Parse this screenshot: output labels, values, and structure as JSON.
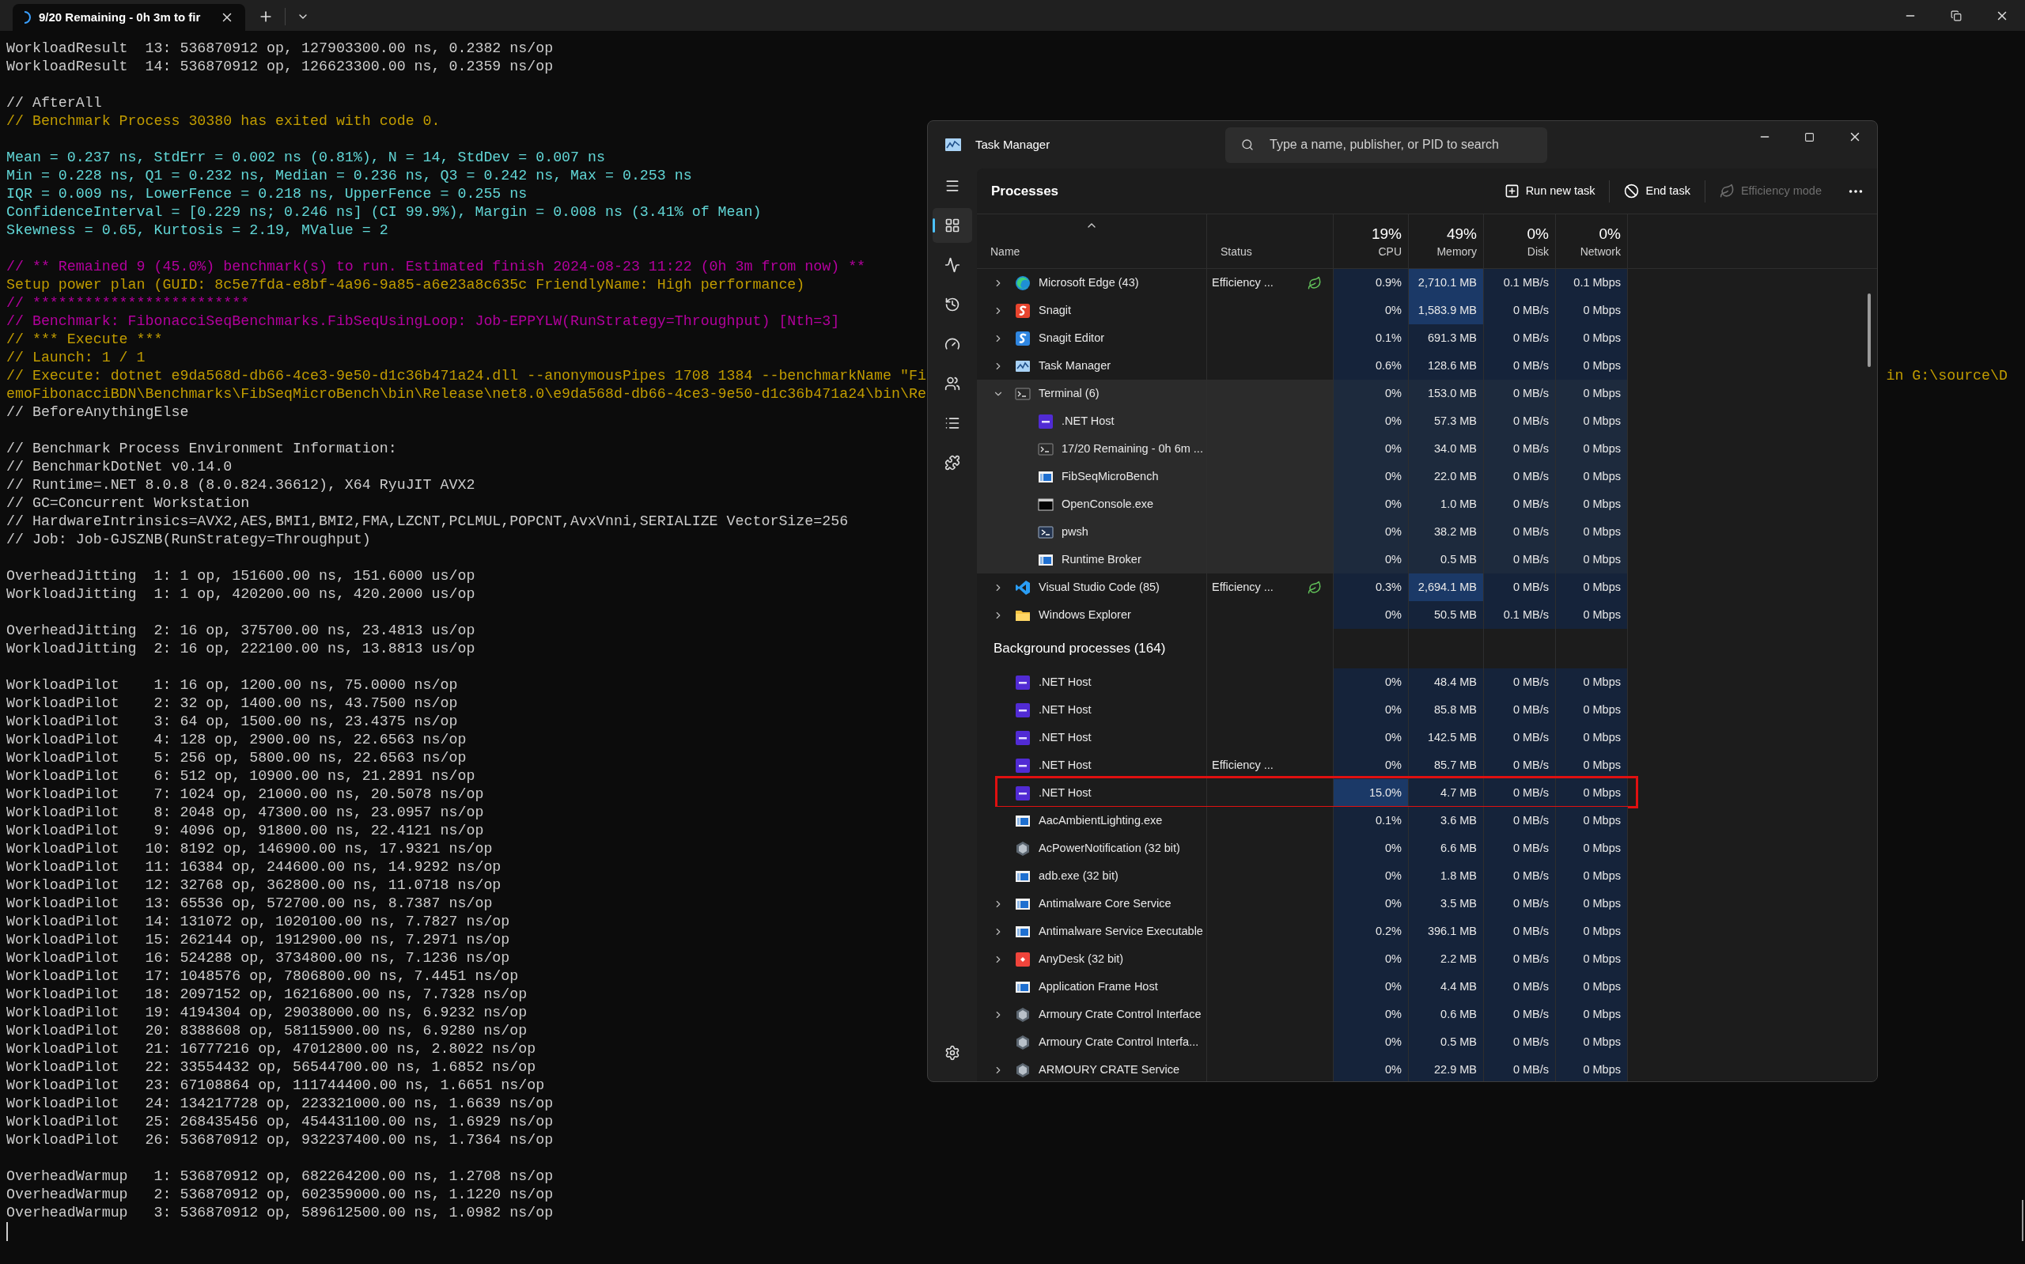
{
  "terminal": {
    "tab": {
      "title": "9/20 Remaining - 0h 3m to fir",
      "busy": true
    },
    "blocks": [
      [
        {
          "text": "WorkloadResult  13: 536870912 op, 127903300.00 ns, 0.2382 ns/op",
          "color": "#cccccc"
        },
        {
          "text": "WorkloadResult  14: 536870912 op, 126623300.00 ns, 0.2359 ns/op",
          "color": "#cccccc"
        }
      ],
      [
        {
          "text": "// AfterAll",
          "color": "#cccccc"
        },
        {
          "text": "// Benchmark Process 30380 has exited with code 0.",
          "color": "#c19c00"
        }
      ],
      [
        {
          "text": "Mean = 0.237 ns, StdErr = 0.002 ns (0.81%), N = 14, StdDev = 0.007 ns",
          "color": "#61d6d6"
        },
        {
          "text": "Min = 0.228 ns, Q1 = 0.232 ns, Median = 0.236 ns, Q3 = 0.242 ns, Max = 0.253 ns",
          "color": "#61d6d6"
        },
        {
          "text": "IQR = 0.009 ns, LowerFence = 0.218 ns, UpperFence = 0.255 ns",
          "color": "#61d6d6"
        },
        {
          "text": "ConfidenceInterval = [0.229 ns; 0.246 ns] (CI 99.9%), Margin = 0.008 ns (3.41% of Mean)",
          "color": "#61d6d6"
        },
        {
          "text": "Skewness = 0.65, Kurtosis = 2.19, MValue = 2",
          "color": "#61d6d6"
        }
      ],
      [
        {
          "text": "// ** Remained 9 (45.0%) benchmark(s) to run. Estimated finish 2024-08-23 11:22 (0h 3m from now) **",
          "color": "#b4009e"
        },
        {
          "text": "Setup power plan (GUID: 8c5e7fda-e8bf-4a96-9a85-a6e23a8c635c FriendlyName: High performance)",
          "color": "#c19c00"
        },
        {
          "text": "// *************************",
          "color": "#b4009e"
        },
        {
          "text": "// Benchmark: FibonacciSeqBenchmarks.FibSeqUsingLoop: Job-EPPYLW(RunStrategy=Throughput) [Nth=3]",
          "color": "#b4009e"
        },
        {
          "text": "// *** Execute ***",
          "color": "#c19c00"
        },
        {
          "text": "// Launch: 1 / 1",
          "color": "#c19c00"
        },
        {
          "text": "// Execute: dotnet e9da568d-db66-4ce3-9e50-d1c36b471a24.dll --anonymousPipes 1708 1384 --benchmarkName \"Fi",
          "right": "in G:\\source\\D",
          "color": "#c19c00"
        },
        {
          "text": "emoFibonacciBDN\\Benchmarks\\FibSeqMicroBench\\bin\\Release\\net8.0\\e9da568d-db66-4ce3-9e50-d1c36b471a24\\bin\\Re",
          "color": "#c19c00"
        },
        {
          "text": "// BeforeAnythingElse",
          "color": "#cccccc"
        }
      ],
      [
        {
          "text": "// Benchmark Process Environment Information:",
          "color": "#cccccc"
        },
        {
          "text": "// BenchmarkDotNet v0.14.0",
          "color": "#cccccc"
        },
        {
          "text": "// Runtime=.NET 8.0.8 (8.0.824.36612), X64 RyuJIT AVX2",
          "color": "#cccccc"
        },
        {
          "text": "// GC=Concurrent Workstation",
          "color": "#cccccc"
        },
        {
          "text": "// HardwareIntrinsics=AVX2,AES,BMI1,BMI2,FMA,LZCNT,PCLMUL,POPCNT,AvxVnni,SERIALIZE VectorSize=256",
          "color": "#cccccc"
        },
        {
          "text": "// Job: Job-GJSZNB(RunStrategy=Throughput)",
          "color": "#cccccc"
        }
      ],
      [
        {
          "text": "OverheadJitting  1: 1 op, 151600.00 ns, 151.6000 us/op",
          "color": "#cccccc"
        },
        {
          "text": "WorkloadJitting  1: 1 op, 420200.00 ns, 420.2000 us/op",
          "color": "#cccccc"
        }
      ],
      [
        {
          "text": "OverheadJitting  2: 16 op, 375700.00 ns, 23.4813 us/op",
          "color": "#cccccc"
        },
        {
          "text": "WorkloadJitting  2: 16 op, 222100.00 ns, 13.8813 us/op",
          "color": "#cccccc"
        }
      ],
      [
        {
          "text": "WorkloadPilot    1: 16 op, 1200.00 ns, 75.0000 ns/op",
          "color": "#cccccc"
        },
        {
          "text": "WorkloadPilot    2: 32 op, 1400.00 ns, 43.7500 ns/op",
          "color": "#cccccc"
        },
        {
          "text": "WorkloadPilot    3: 64 op, 1500.00 ns, 23.4375 ns/op",
          "color": "#cccccc"
        },
        {
          "text": "WorkloadPilot    4: 128 op, 2900.00 ns, 22.6563 ns/op",
          "color": "#cccccc"
        },
        {
          "text": "WorkloadPilot    5: 256 op, 5800.00 ns, 22.6563 ns/op",
          "color": "#cccccc"
        },
        {
          "text": "WorkloadPilot    6: 512 op, 10900.00 ns, 21.2891 ns/op",
          "color": "#cccccc"
        },
        {
          "text": "WorkloadPilot    7: 1024 op, 21000.00 ns, 20.5078 ns/op",
          "color": "#cccccc"
        },
        {
          "text": "WorkloadPilot    8: 2048 op, 47300.00 ns, 23.0957 ns/op",
          "color": "#cccccc"
        },
        {
          "text": "WorkloadPilot    9: 4096 op, 91800.00 ns, 22.4121 ns/op",
          "color": "#cccccc"
        },
        {
          "text": "WorkloadPilot   10: 8192 op, 146900.00 ns, 17.9321 ns/op",
          "color": "#cccccc"
        },
        {
          "text": "WorkloadPilot   11: 16384 op, 244600.00 ns, 14.9292 ns/op",
          "color": "#cccccc"
        },
        {
          "text": "WorkloadPilot   12: 32768 op, 362800.00 ns, 11.0718 ns/op",
          "color": "#cccccc"
        },
        {
          "text": "WorkloadPilot   13: 65536 op, 572700.00 ns, 8.7387 ns/op",
          "color": "#cccccc"
        },
        {
          "text": "WorkloadPilot   14: 131072 op, 1020100.00 ns, 7.7827 ns/op",
          "color": "#cccccc"
        },
        {
          "text": "WorkloadPilot   15: 262144 op, 1912900.00 ns, 7.2971 ns/op",
          "color": "#cccccc"
        },
        {
          "text": "WorkloadPilot   16: 524288 op, 3734800.00 ns, 7.1236 ns/op",
          "color": "#cccccc"
        },
        {
          "text": "WorkloadPilot   17: 1048576 op, 7806800.00 ns, 7.4451 ns/op",
          "color": "#cccccc"
        },
        {
          "text": "WorkloadPilot   18: 2097152 op, 16216800.00 ns, 7.7328 ns/op",
          "color": "#cccccc"
        },
        {
          "text": "WorkloadPilot   19: 4194304 op, 29038000.00 ns, 6.9232 ns/op",
          "color": "#cccccc"
        },
        {
          "text": "WorkloadPilot   20: 8388608 op, 58115900.00 ns, 6.9280 ns/op",
          "color": "#cccccc"
        },
        {
          "text": "WorkloadPilot   21: 16777216 op, 47012800.00 ns, 2.8022 ns/op",
          "color": "#cccccc"
        },
        {
          "text": "WorkloadPilot   22: 33554432 op, 56544700.00 ns, 1.6852 ns/op",
          "color": "#cccccc"
        },
        {
          "text": "WorkloadPilot   23: 67108864 op, 111744400.00 ns, 1.6651 ns/op",
          "color": "#cccccc"
        },
        {
          "text": "WorkloadPilot   24: 134217728 op, 223321000.00 ns, 1.6639 ns/op",
          "color": "#cccccc"
        },
        {
          "text": "WorkloadPilot   25: 268435456 op, 454431100.00 ns, 1.6929 ns/op",
          "color": "#cccccc"
        },
        {
          "text": "WorkloadPilot   26: 536870912 op, 932237400.00 ns, 1.7364 ns/op",
          "color": "#cccccc"
        }
      ],
      [
        {
          "text": "OverheadWarmup   1: 536870912 op, 682264200.00 ns, 1.2708 ns/op",
          "color": "#cccccc"
        },
        {
          "text": "OverheadWarmup   2: 536870912 op, 602359000.00 ns, 1.1220 ns/op",
          "color": "#cccccc"
        },
        {
          "text": "OverheadWarmup   3: 536870912 op, 589612500.00 ns, 1.0982 ns/op",
          "color": "#cccccc"
        }
      ]
    ]
  },
  "task_manager": {
    "window": {
      "title": "Task Manager"
    },
    "search": {
      "placeholder": "Type a name, publisher, or PID to search"
    },
    "nav": [
      {
        "kind": "processes",
        "selected": true
      },
      {
        "kind": "performance",
        "selected": false
      },
      {
        "kind": "history",
        "selected": false
      },
      {
        "kind": "startup",
        "selected": false
      },
      {
        "kind": "users",
        "selected": false
      },
      {
        "kind": "details",
        "selected": false
      },
      {
        "kind": "services",
        "selected": false
      },
      {
        "kind": "settings",
        "selected": false
      }
    ],
    "page_title": "Processes",
    "actions": [
      {
        "label": "Run new task",
        "kind": "run",
        "disabled": false
      },
      {
        "label": "End task",
        "kind": "end",
        "disabled": false
      },
      {
        "label": "Efficiency mode",
        "kind": "leaf",
        "disabled": true
      }
    ],
    "columns": [
      {
        "label": "Name",
        "sorted": true
      },
      {
        "label": "Status",
        "sorted": false
      },
      {
        "usage": "19%",
        "label": "CPU",
        "sorted": false
      },
      {
        "usage": "49%",
        "label": "Memory",
        "sorted": false
      },
      {
        "usage": "0%",
        "label": "Disk",
        "sorted": false
      },
      {
        "usage": "0%",
        "label": "Network",
        "sorted": false
      }
    ],
    "apps": [
      {
        "name": "Microsoft Edge (43)",
        "kind": "edge",
        "expanded": false,
        "status": "Efficiency ...",
        "efficiency": true,
        "cpu": "0.9%",
        "memory": "2,710.1 MB",
        "disk": "0.1 MB/s",
        "network": "0.1 Mbps",
        "cpu_high": false,
        "memory_high": true
      },
      {
        "name": "Snagit",
        "kind": "snagit",
        "expanded": false,
        "efficiency": false,
        "cpu": "0%",
        "memory": "1,583.9 MB",
        "disk": "0 MB/s",
        "network": "0 Mbps",
        "cpu_high": false,
        "memory_high": true
      },
      {
        "name": "Snagit Editor",
        "kind": "editor",
        "expanded": false,
        "efficiency": false,
        "cpu": "0.1%",
        "memory": "691.3 MB",
        "disk": "0 MB/s",
        "network": "0 Mbps",
        "cpu_high": false,
        "memory_high": false
      },
      {
        "name": "Task Manager",
        "kind": "taskmgr",
        "expanded": false,
        "efficiency": false,
        "cpu": "0.6%",
        "memory": "128.6 MB",
        "disk": "0 MB/s",
        "network": "0 Mbps",
        "cpu_high": false,
        "memory_high": false
      },
      {
        "name": "Terminal (6)",
        "kind": "terminal",
        "expanded": true,
        "efficiency": false,
        "cpu": "0%",
        "memory": "153.0 MB",
        "disk": "0 MB/s",
        "network": "0 Mbps",
        "cpu_high": false,
        "memory_high": false,
        "children": [
          {
            "name": ".NET Host",
            "kind": "dotnet",
            "efficiency": false,
            "cpu": "0%",
            "memory": "57.3 MB",
            "disk": "0 MB/s",
            "network": "0 Mbps",
            "cpu_high": false,
            "memory_high": false
          },
          {
            "name": "17/20 Remaining - 0h 6m ...",
            "kind": "terminal",
            "efficiency": false,
            "cpu": "0%",
            "memory": "34.0 MB",
            "disk": "0 MB/s",
            "network": "0 Mbps",
            "cpu_high": false,
            "memory_high": false
          },
          {
            "name": "FibSeqMicroBench",
            "kind": "window",
            "efficiency": false,
            "cpu": "0%",
            "memory": "22.0 MB",
            "disk": "0 MB/s",
            "network": "0 Mbps",
            "cpu_high": false,
            "memory_high": false
          },
          {
            "name": "OpenConsole.exe",
            "kind": "console",
            "efficiency": false,
            "cpu": "0%",
            "memory": "1.0 MB",
            "disk": "0 MB/s",
            "network": "0 Mbps",
            "cpu_high": false,
            "memory_high": false
          },
          {
            "name": "pwsh",
            "kind": "pwsh",
            "efficiency": false,
            "cpu": "0%",
            "memory": "38.2 MB",
            "disk": "0 MB/s",
            "network": "0 Mbps",
            "cpu_high": false,
            "memory_high": false
          },
          {
            "name": "Runtime Broker",
            "kind": "window",
            "efficiency": false,
            "cpu": "0%",
            "memory": "0.5 MB",
            "disk": "0 MB/s",
            "network": "0 Mbps",
            "cpu_high": false,
            "memory_high": false
          }
        ]
      },
      {
        "name": "Visual Studio Code (85)",
        "kind": "vscode",
        "expanded": false,
        "status": "Efficiency ...",
        "efficiency": true,
        "cpu": "0.3%",
        "memory": "2,694.1 MB",
        "disk": "0 MB/s",
        "network": "0 Mbps",
        "cpu_high": false,
        "memory_high": true
      },
      {
        "name": "Windows Explorer",
        "kind": "folder",
        "expanded": false,
        "efficiency": false,
        "cpu": "0%",
        "memory": "50.5 MB",
        "disk": "0.1 MB/s",
        "network": "0 Mbps",
        "cpu_high": false,
        "memory_high": false
      }
    ],
    "background": {
      "title": "Background processes (164)",
      "rows": [
        {
          "name": ".NET Host",
          "kind": "dotnet",
          "efficiency": false,
          "cpu": "0%",
          "memory": "48.4 MB",
          "disk": "0 MB/s",
          "network": "0 Mbps",
          "cpu_high": false,
          "memory_high": false,
          "outlined": false
        },
        {
          "name": ".NET Host",
          "kind": "dotnet",
          "efficiency": false,
          "cpu": "0%",
          "memory": "85.8 MB",
          "disk": "0 MB/s",
          "network": "0 Mbps",
          "cpu_high": false,
          "memory_high": false,
          "outlined": false
        },
        {
          "name": ".NET Host",
          "kind": "dotnet",
          "efficiency": false,
          "cpu": "0%",
          "memory": "142.5 MB",
          "disk": "0 MB/s",
          "network": "0 Mbps",
          "cpu_high": false,
          "memory_high": false,
          "outlined": false
        },
        {
          "name": ".NET Host",
          "kind": "dotnet",
          "status": "Efficiency ...",
          "efficiency": false,
          "cpu": "0%",
          "memory": "85.7 MB",
          "disk": "0 MB/s",
          "network": "0 Mbps",
          "cpu_high": false,
          "memory_high": false,
          "outlined": false
        },
        {
          "name": ".NET Host",
          "kind": "dotnet",
          "efficiency": false,
          "cpu": "15.0%",
          "memory": "4.7 MB",
          "disk": "0 MB/s",
          "network": "0 Mbps",
          "cpu_high": true,
          "memory_high": false,
          "outlined": true
        },
        {
          "name": "AacAmbientLighting.exe",
          "kind": "window",
          "efficiency": false,
          "cpu": "0.1%",
          "memory": "3.6 MB",
          "disk": "0 MB/s",
          "network": "0 Mbps",
          "cpu_high": false,
          "memory_high": false,
          "outlined": false
        },
        {
          "name": "AcPowerNotification (32 bit)",
          "kind": "gem",
          "efficiency": false,
          "cpu": "0%",
          "memory": "6.6 MB",
          "disk": "0 MB/s",
          "network": "0 Mbps",
          "cpu_high": false,
          "memory_high": false,
          "outlined": false
        },
        {
          "name": "adb.exe (32 bit)",
          "kind": "window",
          "efficiency": false,
          "cpu": "0%",
          "memory": "1.8 MB",
          "disk": "0 MB/s",
          "network": "0 Mbps",
          "cpu_high": false,
          "memory_high": false,
          "outlined": false
        },
        {
          "name": "Antimalware Core Service",
          "kind": "window",
          "expanded": false,
          "efficiency": false,
          "cpu": "0%",
          "memory": "3.5 MB",
          "disk": "0 MB/s",
          "network": "0 Mbps",
          "cpu_high": false,
          "memory_high": false,
          "outlined": false
        },
        {
          "name": "Antimalware Service Executable",
          "kind": "window",
          "expanded": false,
          "efficiency": false,
          "cpu": "0.2%",
          "memory": "396.1 MB",
          "disk": "0 MB/s",
          "network": "0 Mbps",
          "cpu_high": false,
          "memory_high": false,
          "outlined": false
        },
        {
          "name": "AnyDesk (32 bit)",
          "kind": "anydesk",
          "expanded": false,
          "efficiency": false,
          "cpu": "0%",
          "memory": "2.2 MB",
          "disk": "0 MB/s",
          "network": "0 Mbps",
          "cpu_high": false,
          "memory_high": false,
          "outlined": false
        },
        {
          "name": "Application Frame Host",
          "kind": "window",
          "efficiency": false,
          "cpu": "0%",
          "memory": "4.4 MB",
          "disk": "0 MB/s",
          "network": "0 Mbps",
          "cpu_high": false,
          "memory_high": false,
          "outlined": false
        },
        {
          "name": "Armoury Crate Control Interface",
          "kind": "gem",
          "expanded": false,
          "efficiency": false,
          "cpu": "0%",
          "memory": "0.6 MB",
          "disk": "0 MB/s",
          "network": "0 Mbps",
          "cpu_high": false,
          "memory_high": false,
          "outlined": false
        },
        {
          "name": "Armoury Crate Control Interfa...",
          "kind": "gem",
          "efficiency": false,
          "cpu": "0%",
          "memory": "0.5 MB",
          "disk": "0 MB/s",
          "network": "0 Mbps",
          "cpu_high": false,
          "memory_high": false,
          "outlined": false
        },
        {
          "name": "ARMOURY CRATE Service",
          "kind": "gem",
          "expanded": false,
          "efficiency": false,
          "cpu": "0%",
          "memory": "22.9 MB",
          "disk": "0 MB/s",
          "network": "0 Mbps",
          "cpu_high": false,
          "memory_high": false,
          "outlined": false
        }
      ]
    }
  }
}
